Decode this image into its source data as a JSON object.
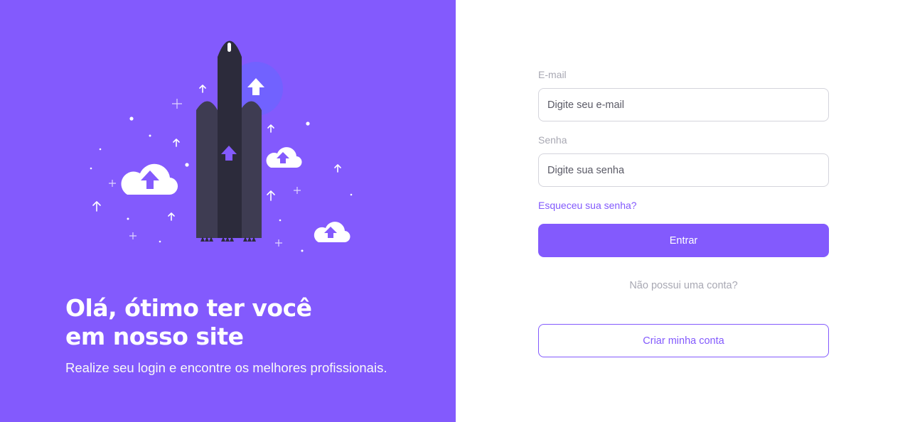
{
  "colors": {
    "brand": "#835afd",
    "white": "#ffffff",
    "label_gray": "#a8a8b3",
    "rocket_dark": "#2c2b3b",
    "rocket_mid": "#3e3c52"
  },
  "hero": {
    "title_line1": "Olá, ótimo ter você",
    "title_line2": "em nosso site",
    "subtitle": "Realize seu login e encontre os melhores profissionais."
  },
  "illustration": {
    "icons": [
      "rocket-icon",
      "cloud-upload-icon",
      "arrow-up-icon",
      "sparkle-icon"
    ]
  },
  "form": {
    "email": {
      "label": "E-mail",
      "placeholder": "Digite seu e-mail",
      "value": ""
    },
    "password": {
      "label": "Senha",
      "placeholder": "Digite sua senha",
      "value": ""
    },
    "forgot_link": "Esqueceu sua senha?",
    "submit_label": "Entrar",
    "no_account_text": "Não possui uma conta?",
    "create_account_label": "Criar minha conta"
  }
}
